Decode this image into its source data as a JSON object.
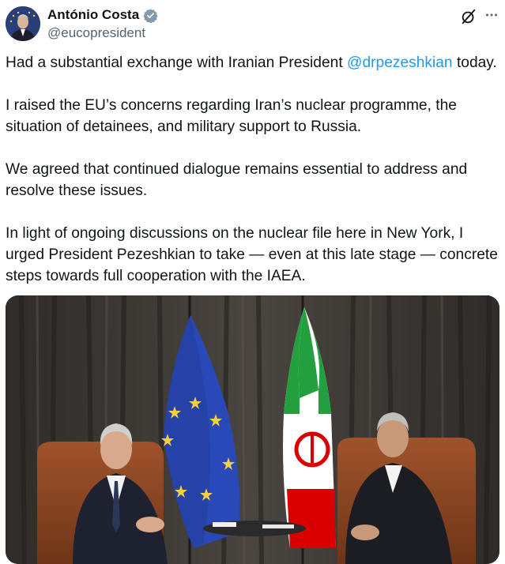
{
  "author": {
    "name": "António Costa",
    "handle": "@eucopresident",
    "verified": true
  },
  "icons": {
    "verified": "verified-badge-icon",
    "grok": "grok-icon",
    "more": "more-icon"
  },
  "tweet": {
    "p1_before": "Had a substantial exchange with Iranian President ",
    "p1_mention": "@drpezeshkian",
    "p1_after": " today.",
    "p2": "I raised the EU’s concerns regarding Iran’s nuclear programme, the situation of detainees, and military support to Russia.",
    "p3": "We agreed that continued dialogue remains essential to address and resolve these issues.",
    "p4": "In light of ongoing discussions on the nuclear file here in New York, I urged President Pezeshkian to take — even at this late stage — concrete steps towards full cooperation with the IAEA."
  },
  "colors": {
    "mention": "#1d9bf0",
    "verified": "#829aab",
    "handle": "#536471",
    "eu_blue": "#2a49b8",
    "eu_star": "#f4d03f",
    "iran_green": "#239f40",
    "iran_red": "#da0000"
  }
}
